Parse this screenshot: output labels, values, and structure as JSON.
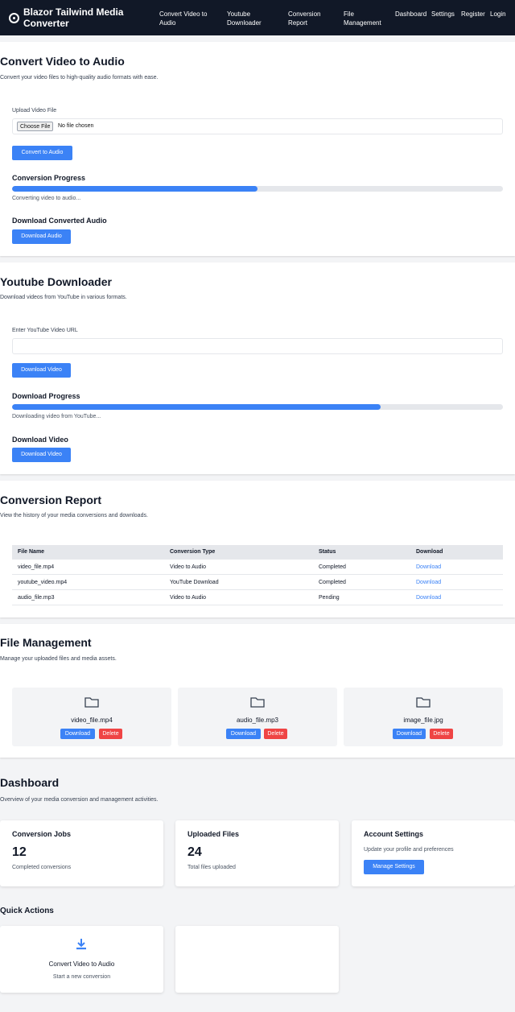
{
  "nav": {
    "brand": "Blazor Tailwind Media Converter",
    "links": [
      "Convert Video to Audio",
      "Youtube Downloader",
      "Conversion Report",
      "File Management",
      "Dashboard",
      "Settings",
      "Register",
      "Login"
    ]
  },
  "convert": {
    "title": "Convert Video to Audio",
    "description": "Convert your video files to high-quality audio formats with ease.",
    "upload_label": "Upload Video File",
    "choose_file": "Choose File",
    "file_status": "No file chosen",
    "convert_button": "Convert to Audio",
    "progress_title": "Conversion Progress",
    "progress_fraction": 0.5,
    "progress_text": "Converting video to audio...",
    "download_title": "Download Converted Audio",
    "download_button": "Download Audio"
  },
  "youtube": {
    "title": "Youtube Downloader",
    "description": "Download videos from YouTube in various formats.",
    "url_label": "Enter YouTube Video URL",
    "url_value": "",
    "download_button": "Download Video",
    "progress_title": "Download Progress",
    "progress_fraction": 0.75,
    "progress_text": "Downloading video from YouTube...",
    "video_title": "Download Video",
    "video_button": "Download Video"
  },
  "report": {
    "title": "Conversion Report",
    "description": "View the history of your media conversions and downloads.",
    "columns": [
      "File Name",
      "Conversion Type",
      "Status",
      "Download"
    ],
    "rows": [
      {
        "file": "video_file.mp4",
        "type": "Video to Audio",
        "status": "Completed",
        "link": "Download"
      },
      {
        "file": "youtube_video.mp4",
        "type": "YouTube Download",
        "status": "Completed",
        "link": "Download"
      },
      {
        "file": "audio_file.mp3",
        "type": "Video to Audio",
        "status": "Pending",
        "link": "Download"
      }
    ]
  },
  "files": {
    "title": "File Management",
    "description": "Manage your uploaded files and media assets.",
    "download_label": "Download",
    "delete_label": "Delete",
    "items": [
      {
        "name": "video_file.mp4",
        "icon": "folder-icon"
      },
      {
        "name": "audio_file.mp3",
        "icon": "folder-icon"
      },
      {
        "name": "image_file.jpg",
        "icon": "folder-icon"
      }
    ]
  },
  "dashboard": {
    "title": "Dashboard",
    "description": "Overview of your media conversion and management activities.",
    "jobs": {
      "title": "Conversion Jobs",
      "value": "12",
      "sub": "Completed conversions"
    },
    "uploads": {
      "title": "Uploaded Files",
      "value": "24",
      "sub": "Total files uploaded"
    },
    "account": {
      "title": "Account Settings",
      "sub": "Update your profile and preferences",
      "button": "Manage Settings"
    },
    "quick_actions_title": "Quick Actions",
    "quick_action": {
      "title": "Convert Video to Audio",
      "sub": "Start a new conversion",
      "icon": "download-icon"
    }
  },
  "colors": {
    "accent": "#3b82f6",
    "danger": "#ef4444",
    "nav_bg": "#111827"
  }
}
